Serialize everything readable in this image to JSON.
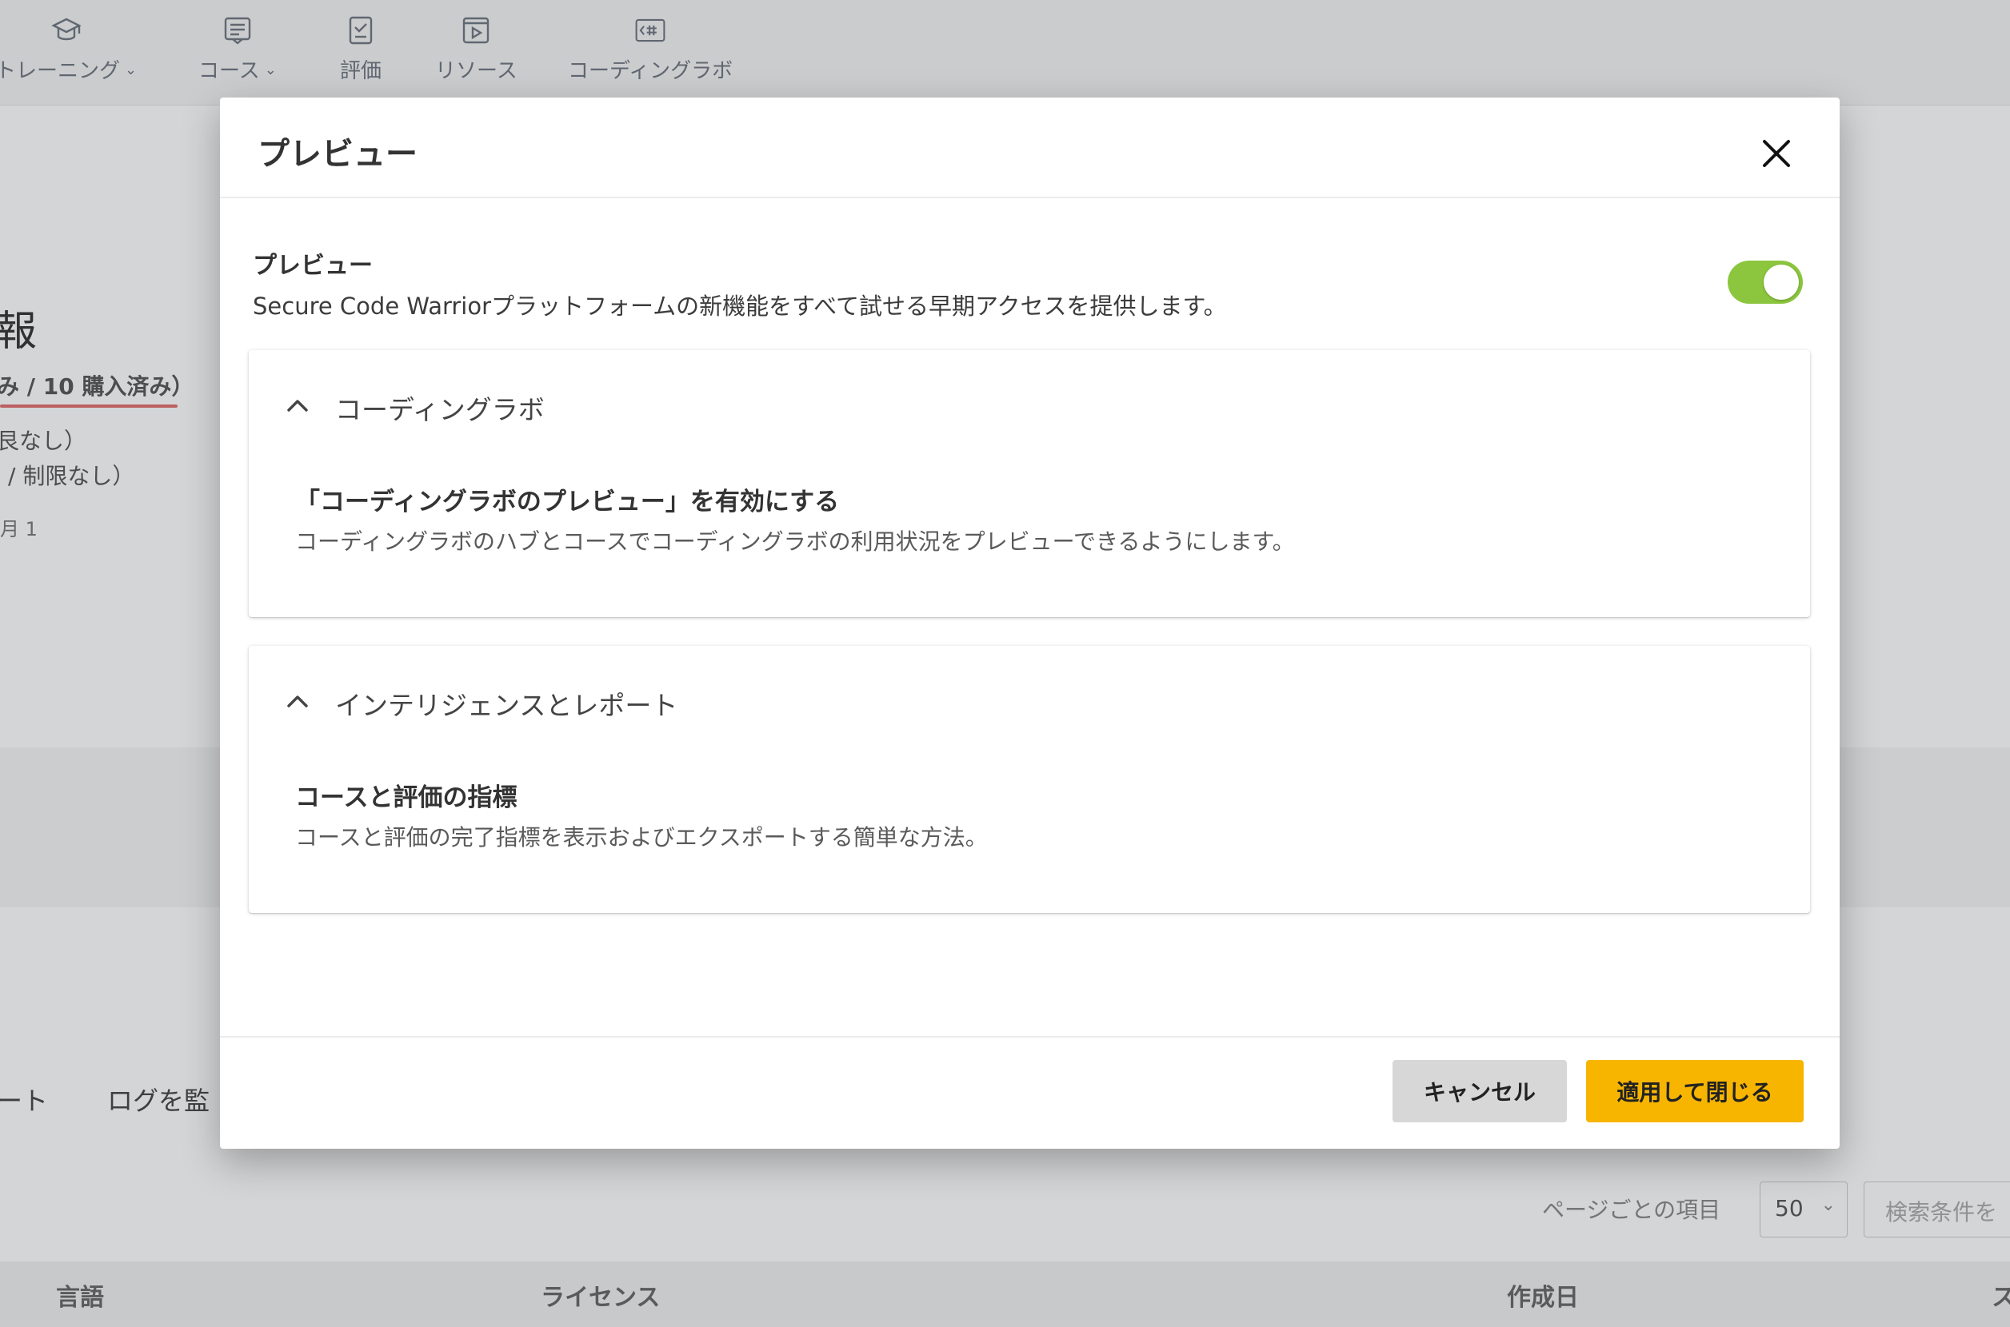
{
  "background": {
    "nav": [
      {
        "label": "トレーニング",
        "icon": "graduation-cap-icon",
        "has_dropdown": true
      },
      {
        "label": "コース",
        "icon": "course-list-icon",
        "has_dropdown": true
      },
      {
        "label": "評価",
        "icon": "assessment-clipboard-icon",
        "has_dropdown": false
      },
      {
        "label": "リソース",
        "icon": "video-play-icon",
        "has_dropdown": false
      },
      {
        "label": "コーディングラボ",
        "icon": "code-lab-icon",
        "has_dropdown": false
      }
    ],
    "section_title": "報",
    "usage_text": "み / 10 購入済み）",
    "line1": "艮なし）",
    "line2": "/ 制限なし）",
    "line3": "月 1",
    "tabs": [
      "ート",
      "ログを監"
    ],
    "per_page_label": "ページごとの項目",
    "per_page_value": "50",
    "search_placeholder": "検索条件を",
    "table_headers": [
      "言語",
      "ライセンス",
      "作成日",
      "ス"
    ]
  },
  "modal": {
    "title": "プレビュー",
    "close_icon": "close-icon",
    "setting": {
      "name": "プレビュー",
      "description": "Secure Code Warriorプラットフォームの新機能をすべて試せる早期アクセスを提供します。",
      "enabled": true,
      "toggle_color": "#8cc63f"
    },
    "panels": [
      {
        "title": "コーディングラボ",
        "expanded": true,
        "feature_name": "「コーディングラボのプレビュー」を有効にする",
        "feature_description": "コーディングラボのハブとコースでコーディングラボの利用状況をプレビューできるようにします。"
      },
      {
        "title": "インテリジェンスとレポート",
        "expanded": true,
        "feature_name": "コースと評価の指標",
        "feature_description": "コースと評価の完了指標を表示およびエクスポートする簡単な方法。"
      }
    ],
    "footer": {
      "cancel_label": "キャンセル",
      "apply_label": "適用して閉じる",
      "apply_color": "#f7b500"
    }
  }
}
